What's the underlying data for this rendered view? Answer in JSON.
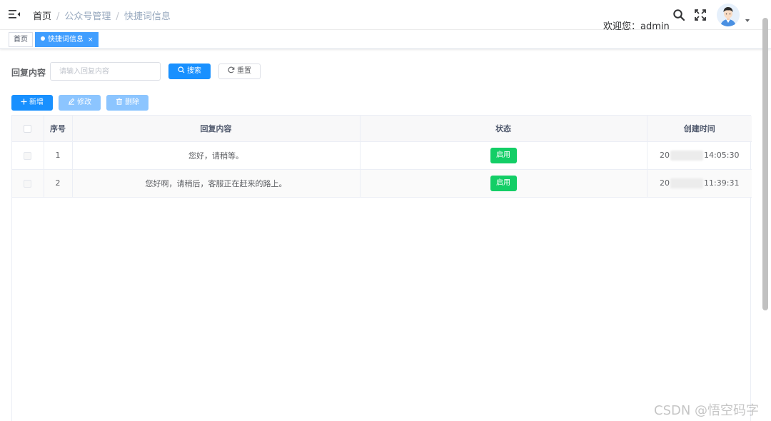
{
  "navbar": {
    "breadcrumb": [
      "首页",
      "公众号管理",
      "快捷词信息"
    ],
    "welcome": "欢迎您：admin"
  },
  "tags": {
    "home": "首页",
    "active": "快捷词信息",
    "close": "×"
  },
  "search": {
    "label": "回复内容",
    "placeholder": "请输入回复内容",
    "search_button": "搜索",
    "reset_button": "重置"
  },
  "toolbar": {
    "add": "新增",
    "edit": "修改",
    "delete": "删除"
  },
  "table": {
    "columns": [
      "序号",
      "回复内容",
      "状态",
      "创建时间"
    ],
    "rows": [
      {
        "index": "1",
        "content": "您好，请稍等。",
        "status": "启用",
        "time_prefix": "20",
        "time_suffix": "14:05:30"
      },
      {
        "index": "2",
        "content": "您好啊，请稍后，客服正在赶来的路上。",
        "status": "启用",
        "time_prefix": "20",
        "time_suffix": "11:39:31"
      }
    ]
  },
  "watermark": "CSDN @悟空码字",
  "colors": {
    "primary": "#1890ff",
    "primary_disabled": "#8cc5ff",
    "success": "#13ce66",
    "active_tag": "#409eff"
  }
}
